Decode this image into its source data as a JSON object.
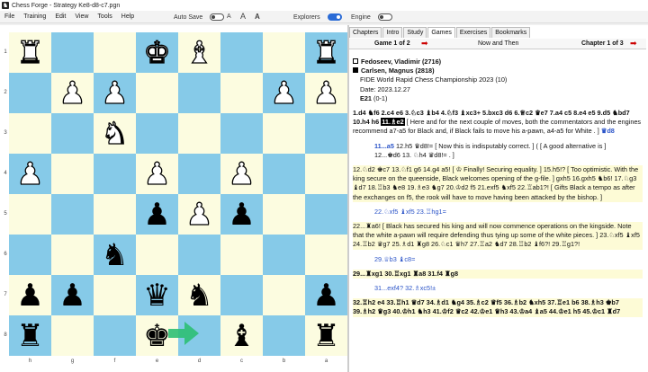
{
  "window": {
    "title": "Chess Forge - Strategy Ke8-d8-c7.pgn"
  },
  "menu": [
    "File",
    "Training",
    "Edit",
    "View",
    "Tools",
    "Help"
  ],
  "toolbar": {
    "autosave_label": "Auto Save",
    "autosave_on": false,
    "font_small": "A",
    "font_large": "A",
    "font_fixed": "A",
    "explorers_label": "Explorers",
    "explorers_on": true,
    "engine_label": "Engine",
    "engine_on": false
  },
  "board": {
    "ranks": [
      "1",
      "2",
      "3",
      "4",
      "5",
      "6",
      "7",
      "8"
    ],
    "files": [
      "h",
      "g",
      "f",
      "e",
      "d",
      "c",
      "b",
      "a"
    ],
    "rows": [
      [
        "R",
        "",
        "",
        "K",
        "B",
        "",
        "",
        "R"
      ],
      [
        "",
        "P",
        "P",
        "",
        "",
        "",
        "P",
        "P"
      ],
      [
        "",
        "",
        "N",
        "",
        "",
        "",
        "",
        ""
      ],
      [
        "P",
        "",
        "",
        "P",
        "",
        "P",
        "",
        ""
      ],
      [
        "",
        "",
        "",
        "p",
        "P",
        "p",
        "",
        ""
      ],
      [
        "",
        "",
        "n",
        "",
        "",
        "",
        "",
        ""
      ],
      [
        "p",
        "p",
        "",
        "q",
        "n",
        "",
        "",
        "p"
      ],
      [
        "r",
        "",
        "",
        "k",
        "",
        "b",
        "",
        "r"
      ]
    ]
  },
  "tabs": [
    "Chapters",
    "Intro",
    "Study",
    "Games",
    "Exercises",
    "Bookmarks"
  ],
  "active_tab": "Games",
  "chapter_bar": {
    "left": "Game 1 of 2",
    "center": "Now and Then",
    "right": "Chapter 1 of 3"
  },
  "game": {
    "white": "Fedoseev, Vladimir (2716)",
    "black": "Carlsen, Magnus (2818)",
    "event": "FIDE World Rapid Chess Championship 2023 (10)",
    "date": "Date: 2023.12.27",
    "eco": "E21",
    "result": "(0-1)"
  },
  "notation": {
    "p1_pre": "1.d4 ♞f6 2.c4 e6 3.♘c3 ♝b4 4.♘f3 ♝xc3+ 5.bxc3 d6 6.♕c2 ♛e7 7.a4 c5 8.e4 e5 9.d5 ♞bd7 10.h4 h6",
    "p1_current": "11.♗e2",
    "p1_post": "[ Here and for the next couple of moves, both the commentators and the engines recommend a7-a5 for Black and, if Black fails to move his a-pawn, a4-a5 for White . ]",
    "p1_tail": "♛d8",
    "sub1_move": "11...a5",
    "sub1_text": "12.h5 ♛d8!= [ Now this is indisputably correct. ] ( [ A good alternative is ]",
    "sub1_line2": "12...♚d6 13. ♘h4 ♛d8!= . ]",
    "p2": "12.♘d2 ♚c7 13.♘f1 g6 14.g4 a5! [ ♔ Finally! Securing equality. ] 15.h5!? [ Too optimistic. With the king secure on the queenside, Black welcomes opening of the g-file. ] gxh5 16.gxh5 ♞b6! 17.♘g3 ♝d7 18.♖b3 ♞e8 19.♗e3 ♞g7 20.♔d2 f5 21.exf5 ♞xf5 22.♖ab1?! [ Gifts Black a tempo as after the exchanges on f5, the rook will have to move having been attacked by the bishop. ]",
    "sub2": "22.♘xf5 ♝xf5 23.♖hg1=",
    "p3": "22...♜a6! [ Black has secured his king and will now commence operations on the kingside. Note that the white a-pawn will require defending thus tying up some of the white pieces. ] 23.♘xf5 ♝xf5 24.♖b2 ♛g7 25.♗d1 ♜g8 26.♘c1 ♛h7 27.♖a2 ♞d7 28.♖b2 ♝f6?! 29.♖g1?!",
    "sub3": "29.♕b3 ♝c8=",
    "p4": "29...♜xg1 30.♖xg1 ♜a8 31.f4 ♜g8",
    "sub4": "31...exf4? 32.♗xc5!±",
    "p5": "32.♖h2 e4 33.♖h1 ♛d7 34.♗d1 ♞g4 35.♗c2 ♛f5 36.♗b2 ♞xh5 37.♖e1 b6 38.♗h3 ♚b7 39.♗h2 ♛g3 40.♔h1 ♞h3 41.♔f2 ♛c2 42.♔e1 ♛h3 43.♔a4 ♝a5 44.♔e1 h5 45.♔c1 ♜d7"
  }
}
